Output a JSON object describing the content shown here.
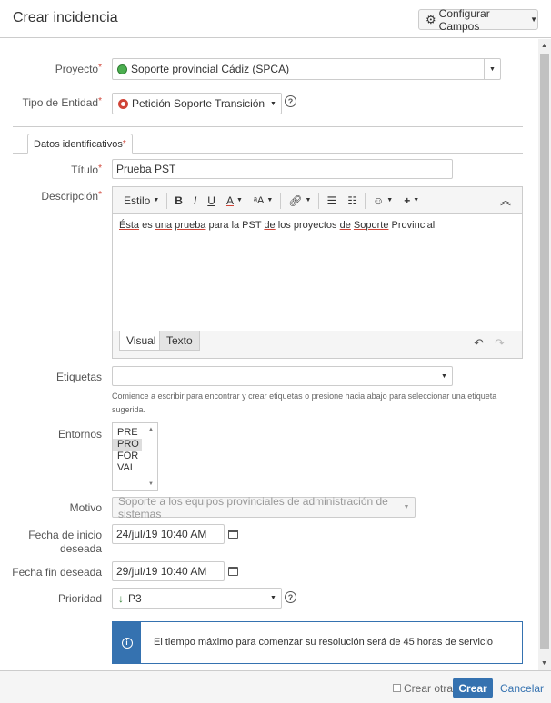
{
  "header": {
    "title": "Crear incidencia",
    "configure_button": "Configurar Campos"
  },
  "fields": {
    "project": {
      "label": "Proyecto",
      "value": "Soporte provincial Cádiz (SPCA)"
    },
    "entity_type": {
      "label": "Tipo de Entidad",
      "value": "Petición Soporte Transición"
    },
    "tab": "Datos identificativos",
    "title": {
      "label": "Título",
      "value": "Prueba PST"
    },
    "description": {
      "label": "Descripción",
      "toolbar": {
        "style": "Estilo",
        "bold": "B",
        "italic": "I",
        "underline": "U",
        "text_color": "A"
      },
      "segments": [
        "Ésta",
        " es ",
        "una",
        " ",
        "prueba",
        " para la PST ",
        "de",
        " los proyectos ",
        "de",
        " ",
        "Soporte",
        " Provincial"
      ],
      "mode_visual": "Visual",
      "mode_text": "Texto"
    },
    "labels": {
      "label": "Etiquetas",
      "value": "",
      "hint": "Comience a escribir para encontrar y crear etiquetas o presione hacia abajo para seleccionar una etiqueta sugerida."
    },
    "environments": {
      "label": "Entornos",
      "options": [
        "PRE",
        "PRO",
        "FOR",
        "VAL"
      ],
      "selected": "PRO"
    },
    "reason": {
      "label": "Motivo",
      "value": "Soporte a los equipos provinciales de administración de sistemas"
    },
    "start_date": {
      "label_line1": "Fecha de inicio",
      "label_line2": "deseada",
      "value": "24/jul/19 10:40 AM"
    },
    "end_date": {
      "label": "Fecha fin deseada",
      "value": "29/jul/19 10:40 AM"
    },
    "priority": {
      "label": "Prioridad",
      "value": "P3"
    },
    "info_message": "El tiempo máximo para comenzar su resolución será de 45 horas de servicio"
  },
  "footer": {
    "create_another": "Crear otra",
    "create_button": "Crear",
    "cancel_link": "Cancelar"
  },
  "colors": {
    "primary": "#3572b0",
    "required": "#d04437",
    "priority_low": "#3b873e"
  }
}
